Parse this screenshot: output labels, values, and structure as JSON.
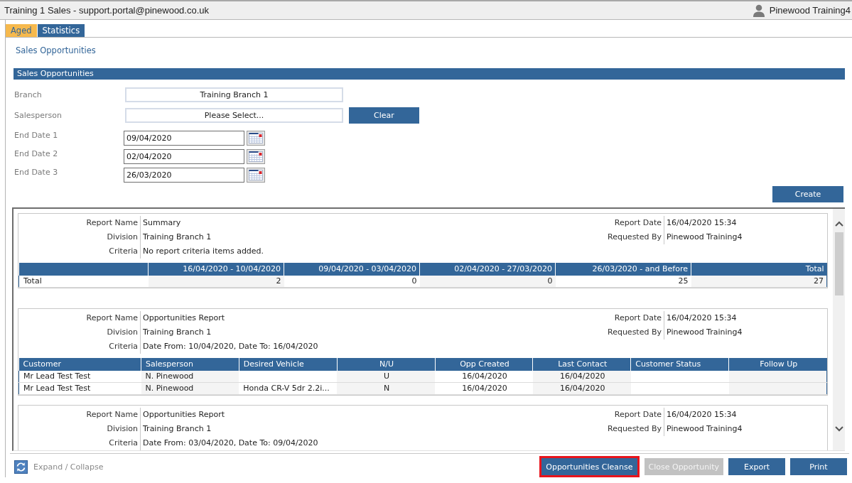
{
  "window": {
    "title": "Training 1 Sales - support.portal@pinewood.co.uk",
    "user": "Pinewood Training4"
  },
  "tabs": [
    {
      "label": "Aged",
      "selected": true
    },
    {
      "label": "Statistics",
      "selected": false
    }
  ],
  "page_title": "Sales Opportunities",
  "criteria": {
    "section_title": "Sales Opportunities",
    "fields": [
      {
        "kind": "select",
        "label": "Branch",
        "value": "Training Branch 1"
      },
      {
        "kind": "select",
        "label": "Salesperson",
        "value": "Please Select...",
        "button": "Clear"
      },
      {
        "kind": "date",
        "label": "End Date 1",
        "value": "09/04/2020"
      },
      {
        "kind": "date",
        "label": "End Date 2",
        "value": "02/04/2020"
      },
      {
        "kind": "date",
        "label": "End Date 3",
        "value": "26/03/2020"
      }
    ],
    "create_button": "Create"
  },
  "reports": [
    {
      "meta_left": [
        {
          "label": "Report Name",
          "value": "Summary"
        },
        {
          "label": "Division",
          "value": "Training Branch 1"
        },
        {
          "label": "Criteria",
          "value": "No report criteria items added."
        }
      ],
      "meta_right": [
        {
          "label": "Report Date",
          "value": "16/04/2020 15:34"
        },
        {
          "label": "Requested By",
          "value": "Pinewood Training4"
        }
      ],
      "table": {
        "columns": [
          {
            "kind": "label"
          },
          {
            "label": "16/04/2020 - 10/04/2020",
            "kind": "number"
          },
          {
            "label": "09/04/2020 - 03/04/2020",
            "kind": "number"
          },
          {
            "label": "02/04/2020 - 27/03/2020",
            "kind": "number"
          },
          {
            "label": "26/03/2020 - and Before",
            "kind": "number"
          },
          {
            "label": "Total",
            "kind": "number"
          }
        ],
        "rows": [
          [
            "Total",
            "2",
            "0",
            "0",
            "25",
            "27"
          ]
        ]
      }
    },
    {
      "meta_left": [
        {
          "label": "Report Name",
          "value": "Opportunities Report"
        },
        {
          "label": "Division",
          "value": "Training Branch 1"
        },
        {
          "label": "Criteria",
          "value": "Date From: 10/04/2020, Date To: 16/04/2020"
        }
      ],
      "meta_right": [
        {
          "label": "Report Date",
          "value": "16/04/2020 15:34"
        },
        {
          "label": "Requested By",
          "value": "Pinewood Training4"
        }
      ],
      "table": {
        "columns": [
          {
            "label": "Customer",
            "kind": "text"
          },
          {
            "label": "Salesperson",
            "kind": "text"
          },
          {
            "label": "Desired Vehicle",
            "kind": "text"
          },
          {
            "label": "N/U",
            "kind": "flag"
          },
          {
            "label": "Opp Created",
            "kind": "date"
          },
          {
            "label": "Last Contact",
            "kind": "date"
          },
          {
            "label": "Customer Status",
            "kind": "text"
          },
          {
            "label": "Follow Up",
            "kind": "date"
          }
        ],
        "rows": [
          [
            "Mr Lead Test Test",
            "N. Pinewood",
            null,
            "U",
            "16/04/2020",
            "16/04/2020",
            null,
            null
          ],
          [
            "Mr Lead Test Test",
            "N. Pinewood",
            "Honda CR-V 5dr 2.2i...",
            "N",
            "16/04/2020",
            "16/04/2020",
            null,
            null
          ]
        ]
      }
    },
    {
      "meta_left": [
        {
          "label": "Report Name",
          "value": "Opportunities Report"
        },
        {
          "label": "Division",
          "value": "Training Branch 1"
        },
        {
          "label": "Criteria",
          "value": "Date From: 03/04/2020, Date To: 09/04/2020"
        }
      ],
      "meta_right": [
        {
          "label": "Report Date",
          "value": "16/04/2020 15:34"
        },
        {
          "label": "Requested By",
          "value": "Pinewood Training4"
        }
      ]
    }
  ],
  "footer": {
    "expand_collapse": "Expand / Collapse",
    "actions": [
      {
        "label": "Opportunities Cleanse",
        "disabled": false,
        "highlighted": true
      },
      {
        "label": "Close Opportunity",
        "disabled": true,
        "highlighted": false
      },
      {
        "label": "Export",
        "disabled": false,
        "highlighted": false
      },
      {
        "label": "Print",
        "disabled": false,
        "highlighted": false
      }
    ]
  }
}
